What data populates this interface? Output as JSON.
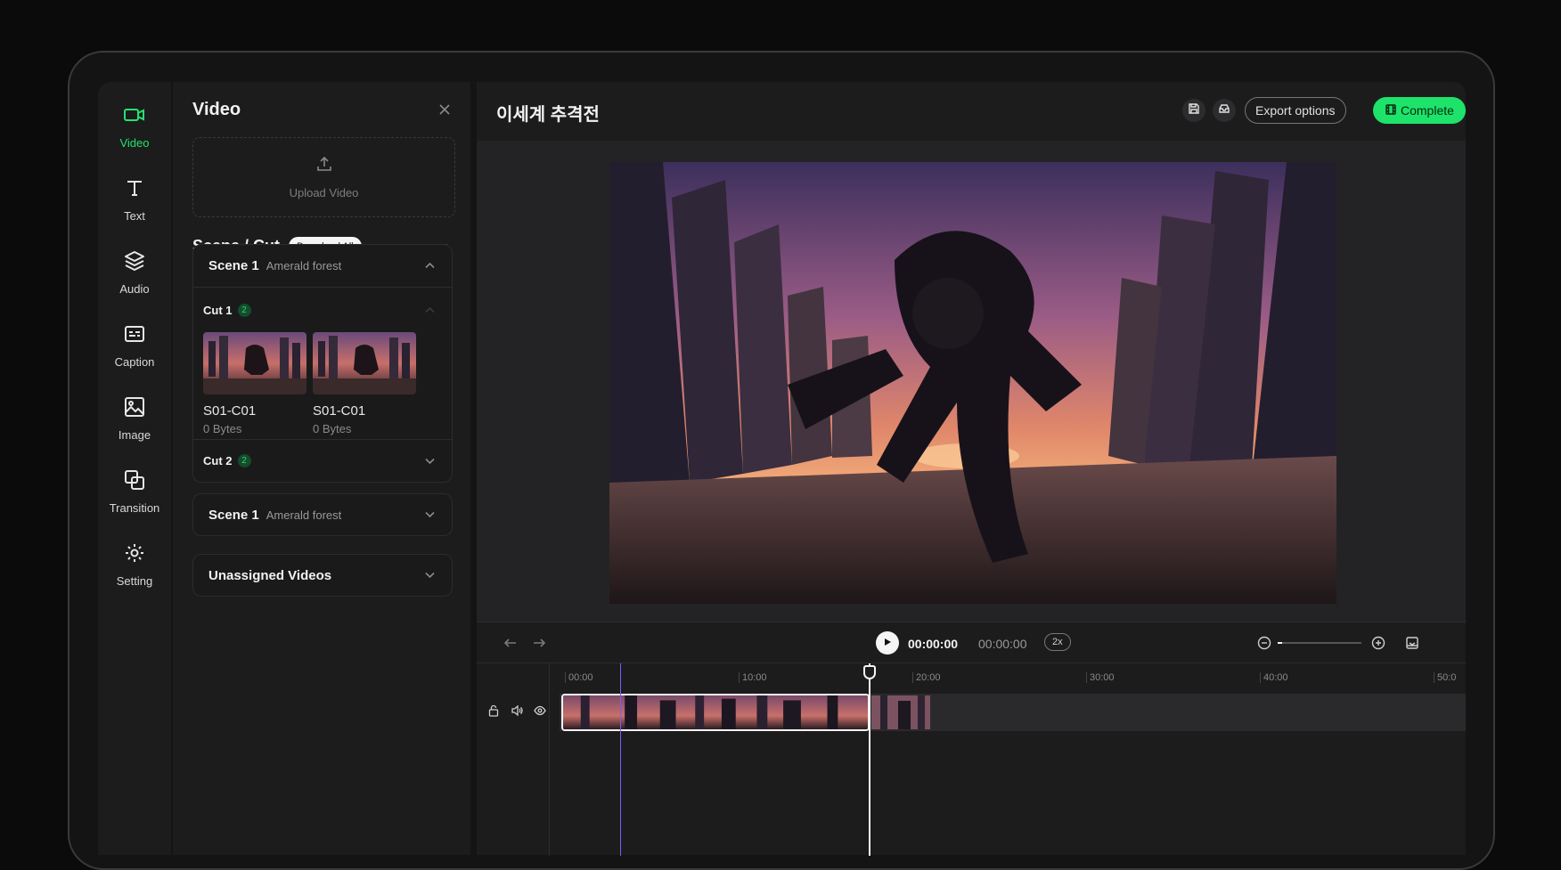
{
  "rail": {
    "items": [
      {
        "label": "Video",
        "icon": "video-icon",
        "active": true
      },
      {
        "label": "Text",
        "icon": "text-icon"
      },
      {
        "label": "Audio",
        "icon": "layers-icon"
      },
      {
        "label": "Caption",
        "icon": "caption-icon"
      },
      {
        "label": "Image",
        "icon": "image-icon"
      },
      {
        "label": "Transition",
        "icon": "transition-icon"
      },
      {
        "label": "Setting",
        "icon": "gear-icon"
      }
    ]
  },
  "panel": {
    "title": "Video",
    "upload_label": "Upload Video",
    "scene_cut_title": "Scene / Cut",
    "download_all": "Download All",
    "scene1": {
      "title": "Scene 1",
      "subtitle": "Amerald forest",
      "cut1": {
        "title": "Cut 1",
        "count": "2",
        "items": [
          {
            "name": "S01-C01",
            "size": "0 Bytes"
          },
          {
            "name": "S01-C01",
            "size": "0 Bytes"
          }
        ]
      },
      "cut2": {
        "title": "Cut 2",
        "count": "2"
      }
    },
    "scene2": {
      "title": "Scene 1",
      "subtitle": "Amerald forest"
    },
    "unassigned": "Unassigned Videos"
  },
  "main": {
    "title": "이세계 추격전",
    "export_label": "Export options",
    "complete_label": "Complete"
  },
  "transport": {
    "current_time": "00:00:00",
    "total_time": "00:00:00",
    "speed": "2x",
    "zoom_level": 0.05
  },
  "timeline": {
    "ruler": [
      "00:00",
      "10:00",
      "20:00",
      "30:00",
      "40:00",
      "50:0"
    ]
  },
  "colors": {
    "accent": "#22e36b",
    "complete_bg": "#1ee36a",
    "marker": "#7a5cff",
    "panel_bg": "#1c1c1d"
  }
}
